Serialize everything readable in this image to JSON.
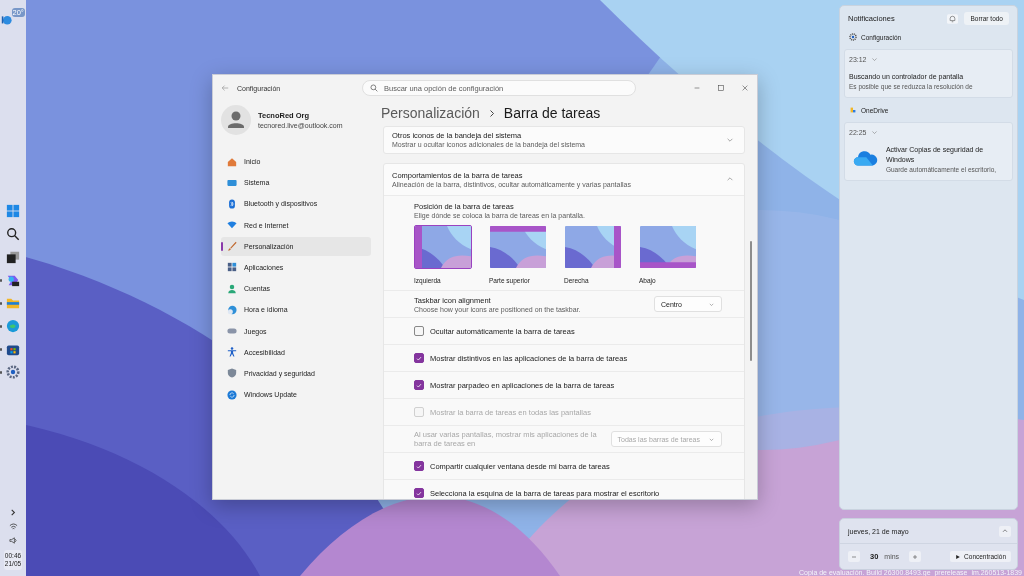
{
  "taskbar": {
    "weather": "20°",
    "apps": [
      {
        "kind": "start",
        "running": false
      },
      {
        "kind": "search",
        "running": false
      },
      {
        "kind": "taskview",
        "running": false
      },
      {
        "kind": "copilot",
        "running": true
      },
      {
        "kind": "folder",
        "running": true
      },
      {
        "kind": "edge",
        "running": true
      },
      {
        "kind": "store",
        "running": true
      },
      {
        "kind": "gear",
        "running": true
      }
    ],
    "time": "00:46",
    "date": "21/05"
  },
  "settings": {
    "title": "Configuración",
    "search": {
      "placeholder": "Buscar una opción de configuración"
    },
    "user": {
      "name": "TecnoRed Org",
      "email": "tecnored.live@outlook.com"
    },
    "nav": [
      {
        "label": "Inicio",
        "selected": false
      },
      {
        "label": "Sistema",
        "selected": false
      },
      {
        "label": "Bluetooth y dispositivos",
        "selected": false
      },
      {
        "label": "Red e Internet",
        "selected": false
      },
      {
        "label": "Personalización",
        "selected": true
      },
      {
        "label": "Aplicaciones",
        "selected": false
      },
      {
        "label": "Cuentas",
        "selected": false
      },
      {
        "label": "Hora e idioma",
        "selected": false
      },
      {
        "label": "Juegos",
        "selected": false
      },
      {
        "label": "Accesibilidad",
        "selected": false
      },
      {
        "label": "Privacidad y seguridad",
        "selected": false
      },
      {
        "label": "Windows Update",
        "selected": false
      }
    ],
    "breadcrumb": {
      "parent": "Personalización",
      "current": "Barra de tareas"
    },
    "sections": [
      {
        "title": "Otros iconos de la bandeja del sistema",
        "subtitle": "Mostrar u ocultar iconos adicionales de la bandeja del sistema",
        "expanded": false
      },
      {
        "title": "Comportamientos de la barra de tareas",
        "subtitle": "Alineación de la barra, distintivos, ocultar automáticamente y varias pantallas",
        "expanded": true
      }
    ],
    "position": {
      "title": "Posición de la barra de tareas",
      "subtitle": "Elige dónde se coloca la barra de tareas en la pantalla.",
      "options": [
        {
          "label": "Izquierda",
          "selected": true
        },
        {
          "label": "Parte superior",
          "selected": false
        },
        {
          "label": "Derecha",
          "selected": false
        },
        {
          "label": "Abajo",
          "selected": false
        }
      ]
    },
    "rows": [
      {
        "kind": "dropdown",
        "title": "Taskbar icon alignment",
        "subtitle": "Choose how your icons are positioned on the taskbar.",
        "value": "Centro",
        "disabled": false
      },
      {
        "kind": "checkbox",
        "title": "Ocultar automáticamente la barra de tareas",
        "checked": false,
        "disabled": false
      },
      {
        "kind": "checkbox",
        "title": "Mostrar distintivos en las aplicaciones de la barra de tareas",
        "checked": true,
        "disabled": false
      },
      {
        "kind": "checkbox",
        "title": "Mostrar parpadeo en aplicaciones de la barra de tareas",
        "checked": true,
        "disabled": false
      },
      {
        "kind": "checkbox",
        "title": "Mostrar la barra de tareas en todas las pantallas",
        "checked": false,
        "disabled": true
      },
      {
        "kind": "dropdown",
        "title": "Al usar varias pantallas, mostrar mis aplicaciones de la barra de tareas en",
        "value": "Todas las barras de tareas",
        "disabled": true
      },
      {
        "kind": "checkbox",
        "title": "Compartir cualquier ventana desde mi barra de tareas",
        "checked": true,
        "disabled": false
      },
      {
        "kind": "checkbox",
        "title": "Selecciona la esquina de la barra de tareas para mostrar el escritorio",
        "checked": true,
        "disabled": false
      }
    ]
  },
  "notifications": {
    "title": "Notificaciones",
    "clear": "Borrar todo",
    "groups": [
      {
        "app": "Configuración",
        "time": "23:12",
        "title": "Buscando un controlador de pantalla",
        "body": "Es posible que se reduzca la resolución de",
        "image": false
      },
      {
        "app": "OneDrive",
        "time": "22:25",
        "title": "Activar Copias de seguridad de Windows",
        "body": "Guarde automáticamente el escritorio,",
        "image": true
      }
    ]
  },
  "calendar": {
    "date": "jueves, 21 de mayo",
    "minutes": "30",
    "unit": "mins",
    "focus": "Concentración"
  },
  "watermark": "Copia de evaluación. Build 26300.8493.ge_prerelease_im.260513-1839"
}
